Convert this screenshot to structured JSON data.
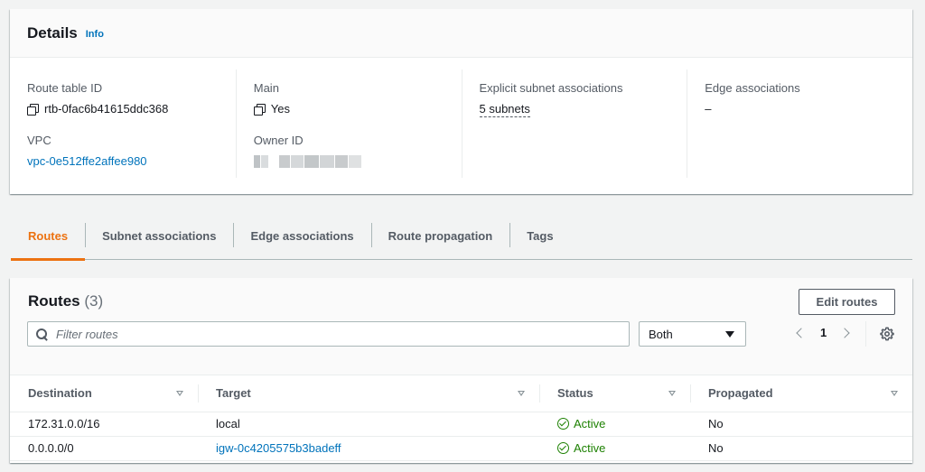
{
  "details": {
    "title": "Details",
    "info": "Info",
    "route_table_id_label": "Route table ID",
    "route_table_id": "rtb-0fac6b41615ddc368",
    "vpc_label": "VPC",
    "vpc": "vpc-0e512ffe2affee980",
    "main_label": "Main",
    "main": "Yes",
    "owner_id_label": "Owner ID",
    "explicit_label": "Explicit subnet associations",
    "explicit": "5 subnets",
    "edge_label": "Edge associations",
    "edge": "–"
  },
  "tabs": [
    {
      "label": "Routes",
      "active": true
    },
    {
      "label": "Subnet associations",
      "active": false
    },
    {
      "label": "Edge associations",
      "active": false
    },
    {
      "label": "Route propagation",
      "active": false
    },
    {
      "label": "Tags",
      "active": false
    }
  ],
  "routes": {
    "title": "Routes",
    "count": "(3)",
    "edit_button": "Edit routes",
    "filter_placeholder": "Filter routes",
    "select_value": "Both",
    "page": "1",
    "columns": [
      "Destination",
      "Target",
      "Status",
      "Propagated"
    ],
    "rows": [
      {
        "destination": "172.31.0.0/16",
        "target": "local",
        "target_link": false,
        "status": "Active",
        "propagated": "No"
      },
      {
        "destination": "0.0.0.0/0",
        "target": "igw-0c4205575b3badeff",
        "target_link": true,
        "status": "Active",
        "propagated": "No"
      }
    ]
  },
  "colors": {
    "accent": "#ec7211",
    "link": "#0073bb",
    "success": "#1d8102"
  },
  "icons": [
    "copy-icon",
    "search-icon",
    "dropdown-caret-icon",
    "chevron-left-icon",
    "chevron-right-icon",
    "gear-icon",
    "status-ok-icon",
    "sort-icon"
  ]
}
